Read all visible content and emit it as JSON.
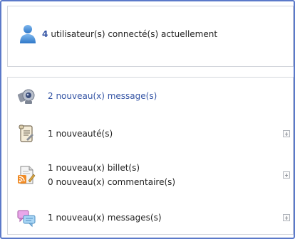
{
  "online": {
    "count": "4",
    "text": "utilisateur(s) connecté(s) actuellement",
    "icon": "user-icon"
  },
  "news": {
    "items": [
      {
        "icon": "webcam-icon",
        "lines": [
          "2 nouveau(x) message(s)"
        ],
        "expandable": false
      },
      {
        "icon": "scroll-note-icon",
        "lines": [
          "1 nouveauté(s)"
        ],
        "expandable": true
      },
      {
        "icon": "rss-document-icon",
        "lines": [
          "1 nouveau(x) billet(s)",
          "0 nouveau(x) commentaire(s)"
        ],
        "expandable": true
      },
      {
        "icon": "chat-bubbles-icon",
        "lines": [
          "1 nouveau(x) messages(s)"
        ],
        "expandable": true
      }
    ]
  },
  "colors": {
    "frame_border": "#5b79c9",
    "link": "#3555a5",
    "panel_border": "#d3d6dc"
  }
}
